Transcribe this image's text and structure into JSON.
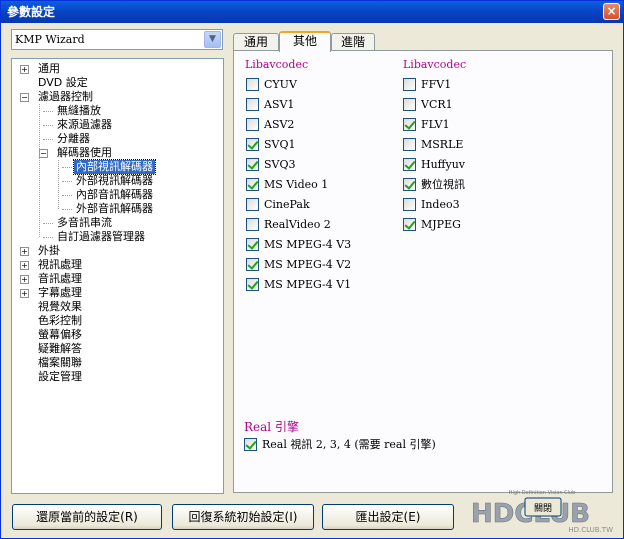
{
  "window": {
    "title": "參數設定",
    "close": "×"
  },
  "preset": {
    "value": "KMP Wizard",
    "arrow": "▼"
  },
  "tree": [
    {
      "label": "通用",
      "toggle": "+"
    },
    {
      "label": "DVD 設定"
    },
    {
      "label": "濾過器控制",
      "toggle": "−"
    },
    {
      "label": "無縫播放"
    },
    {
      "label": "來源過濾器"
    },
    {
      "label": "分離器"
    },
    {
      "label": "解碼器使用",
      "toggle": "−"
    },
    {
      "label": "內部視訊解碼器"
    },
    {
      "label": "外部視訊解碼器"
    },
    {
      "label": "內部音訊解碼器"
    },
    {
      "label": "外部音訊解碼器"
    },
    {
      "label": "多音訊串流"
    },
    {
      "label": "自訂過濾器管理器"
    },
    {
      "label": "外掛",
      "toggle": "+"
    },
    {
      "label": "視訊處理",
      "toggle": "+"
    },
    {
      "label": "音訊處理",
      "toggle": "+"
    },
    {
      "label": "字幕處理",
      "toggle": "+"
    },
    {
      "label": "視覺效果"
    },
    {
      "label": "色彩控制"
    },
    {
      "label": "螢幕偏移"
    },
    {
      "label": "疑難解答"
    },
    {
      "label": "檔案關聯"
    },
    {
      "label": "設定管理"
    }
  ],
  "tabs": [
    "通用",
    "其他",
    "進階"
  ],
  "left_group": {
    "title": "Libavcodec",
    "items": [
      {
        "label": "CYUV",
        "checked": false
      },
      {
        "label": "ASV1",
        "checked": false
      },
      {
        "label": "ASV2",
        "checked": false
      },
      {
        "label": "SVQ1",
        "checked": true
      },
      {
        "label": "SVQ3",
        "checked": true
      },
      {
        "label": "MS Video 1",
        "checked": true
      },
      {
        "label": "CinePak",
        "checked": false
      },
      {
        "label": "RealVideo 2",
        "checked": false
      },
      {
        "label": "MS MPEG-4 V3",
        "checked": true
      },
      {
        "label": "MS MPEG-4 V2",
        "checked": true
      },
      {
        "label": "MS MPEG-4 V1",
        "checked": true
      }
    ]
  },
  "right_group": {
    "title": "Libavcodec",
    "items": [
      {
        "label": "FFV1",
        "checked": false
      },
      {
        "label": "VCR1",
        "checked": false
      },
      {
        "label": "FLV1",
        "checked": true
      },
      {
        "label": "MSRLE",
        "checked": false
      },
      {
        "label": "Huffyuv",
        "checked": true
      },
      {
        "label": "數位視訊",
        "checked": true
      },
      {
        "label": "Indeo3",
        "checked": false
      },
      {
        "label": "MJPEG",
        "checked": true
      }
    ]
  },
  "real_group": {
    "title": "Real 引擎",
    "item": {
      "label": "Real 視訊 2, 3, 4 (需要 real 引擎)",
      "checked": true
    }
  },
  "buttons": {
    "restore": "還原當前的設定(R)",
    "reset": "回復系統初始設定(I)",
    "export": "匯出設定(E)"
  },
  "watermark": {
    "brand": "HDCLUB",
    "site": "HD.CLUB.TW",
    "tagline": "High Definition Vision Club",
    "button": "關閉"
  },
  "colors": {
    "accent": "#b2008f",
    "selection": "#316ac5",
    "title_bar": "#0843c4"
  }
}
